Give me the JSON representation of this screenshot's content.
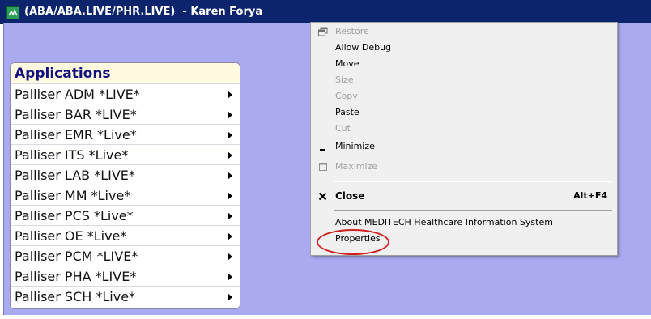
{
  "window": {
    "title_path": "(ABA/ABA.LIVE/PHR.LIVE)",
    "title_user": "  - Karen Forya",
    "icon": "meditech-app-icon"
  },
  "colors": {
    "titlebar": "#0b246b",
    "client_bg": "#aaaaf0",
    "apps_header_bg": "#fffadf",
    "apps_header_text": "#12127e",
    "annotation": "#d02020"
  },
  "applications": {
    "header": "Applications",
    "items": [
      {
        "label": "Palliser ADM *LIVE*"
      },
      {
        "label": "Palliser BAR *LIVE*"
      },
      {
        "label": "Palliser EMR *Live*"
      },
      {
        "label": "Palliser ITS *Live*"
      },
      {
        "label": "Palliser LAB *LIVE*"
      },
      {
        "label": "Palliser MM *Live*"
      },
      {
        "label": "Palliser PCS *Live*"
      },
      {
        "label": "Palliser OE *Live*"
      },
      {
        "label": "Palliser PCM *LIVE*"
      },
      {
        "label": "Palliser PHA *LIVE*"
      },
      {
        "label": "Palliser SCH *Live*"
      }
    ]
  },
  "context_menu": {
    "restore": "Restore",
    "allow_debug": "Allow Debug",
    "move": "Move",
    "size": "Size",
    "copy": "Copy",
    "paste": "Paste",
    "cut": "Cut",
    "minimize": "Minimize",
    "maximize": "Maximize",
    "close": "Close",
    "close_shortcut": "Alt+F4",
    "about": "About MEDITECH Healthcare Information System",
    "properties": "Properties"
  }
}
